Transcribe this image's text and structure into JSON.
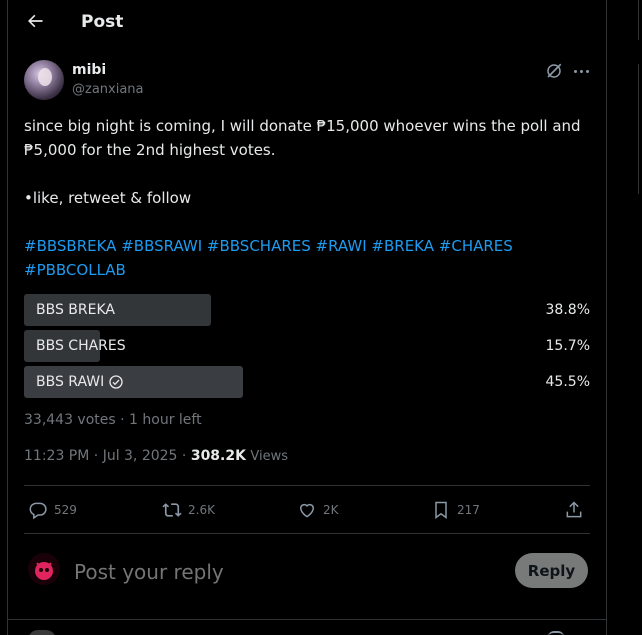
{
  "header": {
    "title": "Post"
  },
  "author": {
    "name": "mibi",
    "handle": "@zanxiana"
  },
  "post": {
    "line1": "since big night is coming, I will donate ₱15,000 whoever wins the poll and",
    "line2": "₱5,000 for the 2nd highest votes.",
    "line3": "•like, retweet & follow",
    "hashtags": [
      "#BBSBREKA",
      "#BBSRAWI",
      "#BBSCHARES",
      "#RAWI",
      "#BREKA",
      "#CHARES",
      "#PBBCOLLAB"
    ]
  },
  "poll": {
    "options": [
      {
        "label": "BBS BREKA",
        "percent": "38.8%",
        "share": 0.388,
        "winner": false
      },
      {
        "label": "BBS CHARES",
        "percent": "15.7%",
        "share": 0.157,
        "winner": false
      },
      {
        "label": "BBS RAWI",
        "percent": "45.5%",
        "share": 0.455,
        "winner": true
      }
    ],
    "votes": "33,443 votes",
    "time_left": "1 hour left"
  },
  "meta": {
    "time": "11:23 PM",
    "date": "Jul 3, 2025",
    "views": "308.2K",
    "views_label": "Views"
  },
  "actions": {
    "replies": "529",
    "reposts": "2.6K",
    "likes": "2K",
    "bookmarks": "217"
  },
  "reply": {
    "placeholder": "Post your reply",
    "button": "Reply"
  },
  "colors": {
    "accent": "#1d9bf0",
    "background": "#000000",
    "muted": "#71767b",
    "text": "#e7e9ea"
  }
}
